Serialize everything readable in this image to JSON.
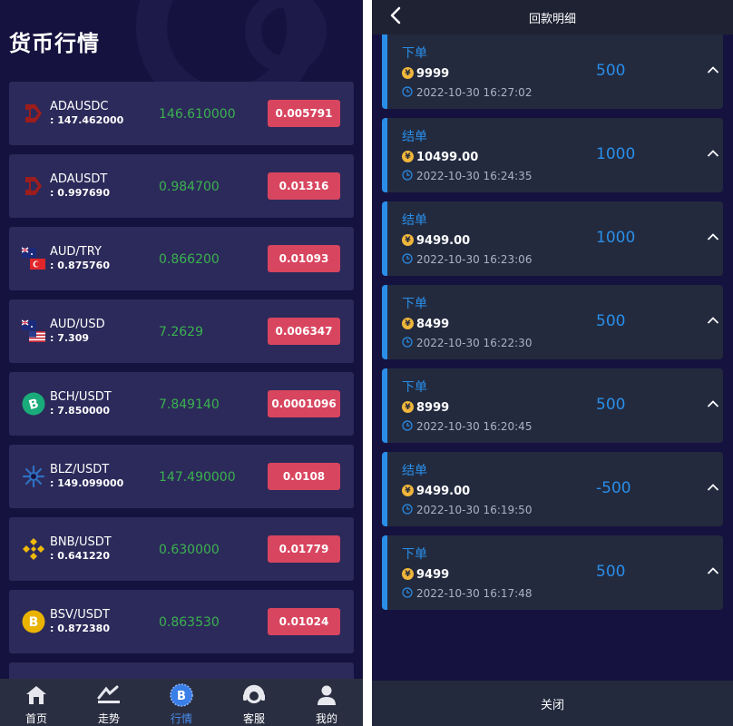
{
  "market": {
    "title": "货币行情",
    "rows": [
      {
        "icon": "ada-logo-icon",
        "name": "ADAUSDC",
        "sub": ": 147.462000",
        "price": "146.610000",
        "change": "0.005791"
      },
      {
        "icon": "ada-logo-icon",
        "name": "ADAUSDT",
        "sub": ": 0.997690",
        "price": "0.984700",
        "change": "0.01316"
      },
      {
        "icon": "aud-try-flags-icon",
        "name": "AUD/TRY",
        "sub": ": 0.875760",
        "price": "0.866200",
        "change": "0.01093"
      },
      {
        "icon": "aud-usd-flags-icon",
        "name": "AUD/USD",
        "sub": ": 7.309",
        "price": "7.2629",
        "change": "0.006347"
      },
      {
        "icon": "bch-coin-icon",
        "name": "BCH/USDT",
        "sub": ": 7.850000",
        "price": "7.849140",
        "change": "0.0001096"
      },
      {
        "icon": "blz-coin-icon",
        "name": "BLZ/USDT",
        "sub": ": 149.099000",
        "price": "147.490000",
        "change": "0.0108"
      },
      {
        "icon": "bnb-coin-icon",
        "name": "BNB/USDT",
        "sub": ": 0.641220",
        "price": "0.630000",
        "change": "0.01779"
      },
      {
        "icon": "bsv-coin-icon",
        "name": "BSV/USDT",
        "sub": ": 0.872380",
        "price": "0.863530",
        "change": "0.01024"
      }
    ]
  },
  "nav": [
    {
      "label": "首页",
      "icon": "home-icon"
    },
    {
      "label": "走势",
      "icon": "trend-icon"
    },
    {
      "label": "行情",
      "icon": "bitcoin-icon",
      "active": true
    },
    {
      "label": "客服",
      "icon": "headset-icon"
    },
    {
      "label": "我的",
      "icon": "user-icon"
    }
  ],
  "detail": {
    "title": "回款明细",
    "close_label": "关闭",
    "records": [
      {
        "type": "下单",
        "amount": "9999",
        "time": "2022-10-30 16:27:02",
        "value": "500"
      },
      {
        "type": "结单",
        "amount": "10499.00",
        "time": "2022-10-30 16:24:35",
        "value": "1000"
      },
      {
        "type": "结单",
        "amount": "9499.00",
        "time": "2022-10-30 16:23:06",
        "value": "1000"
      },
      {
        "type": "下单",
        "amount": "8499",
        "time": "2022-10-30 16:22:30",
        "value": "500"
      },
      {
        "type": "下单",
        "amount": "8999",
        "time": "2022-10-30 16:20:45",
        "value": "500"
      },
      {
        "type": "结单",
        "amount": "9499.00",
        "time": "2022-10-30 16:19:50",
        "value": "-500"
      },
      {
        "type": "下单",
        "amount": "9499",
        "time": "2022-10-30 16:17:48",
        "value": "500"
      }
    ]
  },
  "colors": {
    "background": "#16123f",
    "row_bg": "#2c2a5a",
    "price_green": "#3bb24f",
    "change_red": "#d8455f",
    "accent_blue": "#2a8ee8"
  }
}
